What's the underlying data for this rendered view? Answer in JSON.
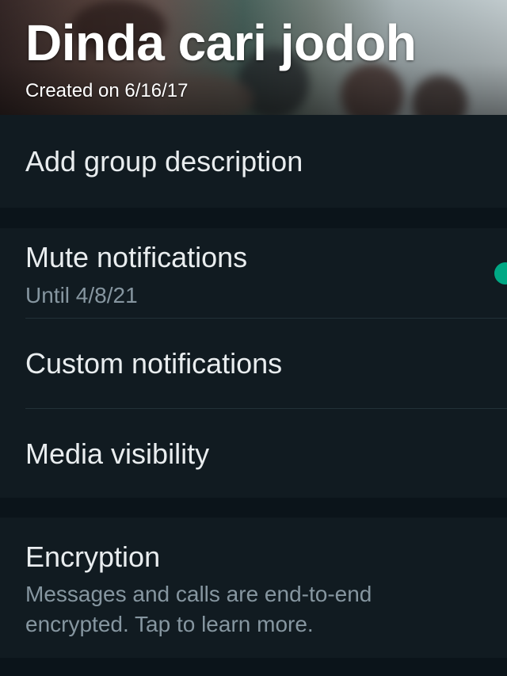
{
  "header": {
    "title": "Dinda cari jodoh",
    "created": "Created on 6/16/17"
  },
  "description": {
    "label": "Add group description"
  },
  "notifications": {
    "mute": {
      "label": "Mute notifications",
      "sub": "Until 4/8/21",
      "on": true
    },
    "custom": {
      "label": "Custom notifications"
    },
    "media": {
      "label": "Media visibility"
    }
  },
  "encryption": {
    "label": "Encryption",
    "sub": "Messages and calls are end-to-end encrypted. Tap to learn more."
  },
  "colors": {
    "background": "#0b141a",
    "card": "#111b21",
    "primary_text": "#e9edef",
    "secondary_text": "#8696a0",
    "accent": "#00a884"
  }
}
